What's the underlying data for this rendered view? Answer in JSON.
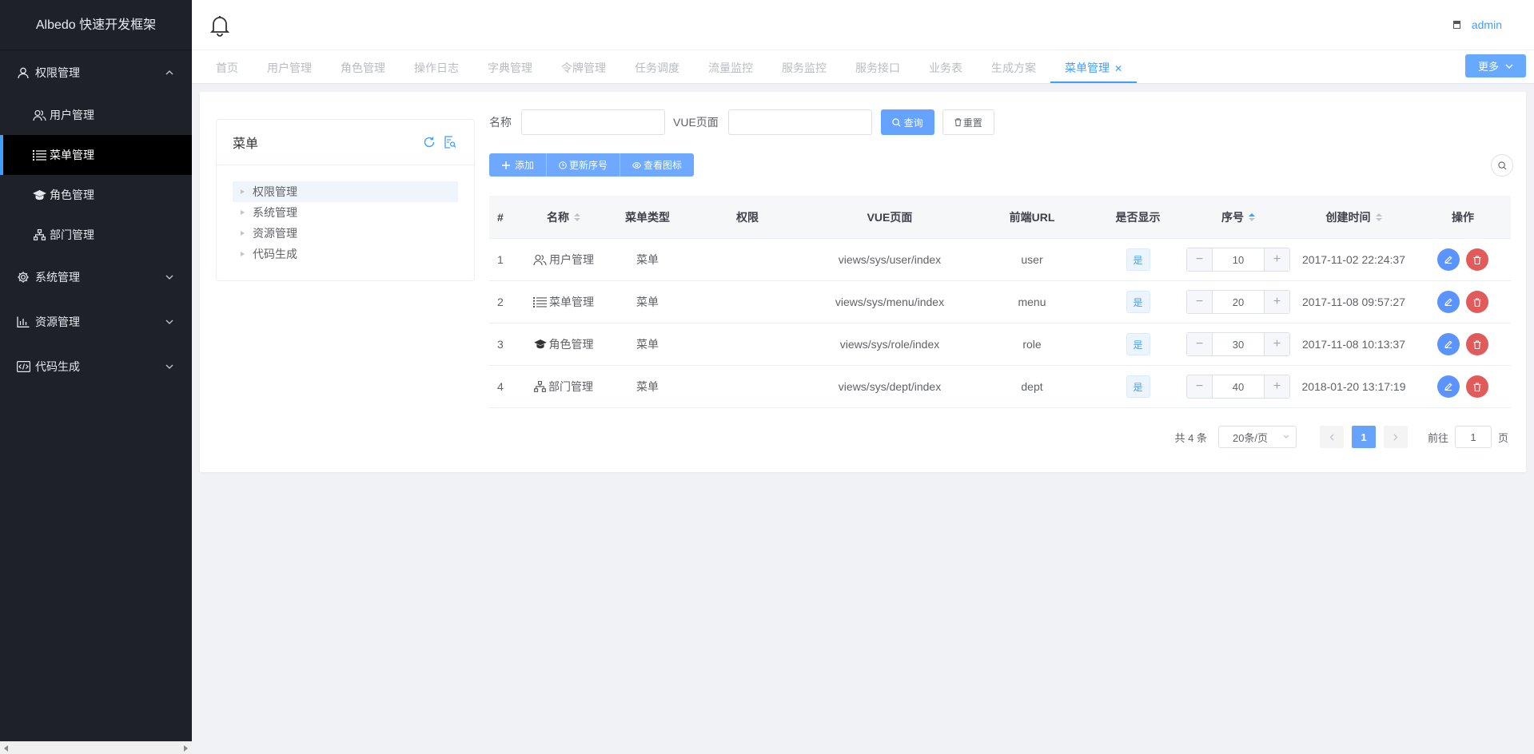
{
  "app": {
    "title": "Albedo 快速开发框架"
  },
  "sidebar": {
    "groups": [
      {
        "label": "权限管理",
        "icon": "user-icon",
        "expanded": true,
        "items": [
          {
            "label": "用户管理",
            "icon": "users-icon"
          },
          {
            "label": "菜单管理",
            "icon": "list-icon",
            "active": true
          },
          {
            "label": "角色管理",
            "icon": "graduation-cap-icon"
          },
          {
            "label": "部门管理",
            "icon": "sitemap-icon"
          }
        ]
      },
      {
        "label": "系统管理",
        "icon": "gear-icon"
      },
      {
        "label": "资源管理",
        "icon": "bar-chart-icon"
      },
      {
        "label": "代码生成",
        "icon": "code-icon"
      }
    ]
  },
  "header": {
    "user": "admin"
  },
  "tabs": {
    "items": [
      "首页",
      "用户管理",
      "角色管理",
      "操作日志",
      "字典管理",
      "令牌管理",
      "任务调度",
      "流量监控",
      "服务监控",
      "服务接口",
      "业务表",
      "生成方案",
      "菜单管理"
    ],
    "active": "菜单管理",
    "more_label": "更多"
  },
  "tree": {
    "title": "菜单",
    "nodes": [
      "权限管理",
      "系统管理",
      "资源管理",
      "代码生成"
    ]
  },
  "search": {
    "name_label": "名称",
    "vue_label": "VUE页面",
    "query_label": "查询",
    "reset_label": "重置"
  },
  "toolbar": {
    "add_label": "添加",
    "update_sort_label": "更新序号",
    "view_icons_label": "查看图标"
  },
  "table": {
    "headers": [
      "#",
      "名称",
      "菜单类型",
      "权限",
      "VUE页面",
      "前端URL",
      "是否显示",
      "序号",
      "创建时间",
      "操作"
    ],
    "rows": [
      {
        "idx": "1",
        "icon": "users-icon",
        "name": "用户管理",
        "type": "菜单",
        "perm": "",
        "vue": "views/sys/user/index",
        "url": "user",
        "show": "是",
        "sort": "10",
        "created": "2017-11-02 22:24:37"
      },
      {
        "idx": "2",
        "icon": "list-icon",
        "name": "菜单管理",
        "type": "菜单",
        "perm": "",
        "vue": "views/sys/menu/index",
        "url": "menu",
        "show": "是",
        "sort": "20",
        "created": "2017-11-08 09:57:27"
      },
      {
        "idx": "3",
        "icon": "graduation-cap-icon",
        "name": "角色管理",
        "type": "菜单",
        "perm": "",
        "vue": "views/sys/role/index",
        "url": "role",
        "show": "是",
        "sort": "30",
        "created": "2017-11-08 10:13:37"
      },
      {
        "idx": "4",
        "icon": "sitemap-icon",
        "name": "部门管理",
        "type": "菜单",
        "perm": "",
        "vue": "views/sys/dept/index",
        "url": "dept",
        "show": "是",
        "sort": "40",
        "created": "2018-01-20 13:17:19"
      }
    ]
  },
  "pagination": {
    "total_text": "共 4 条",
    "page_size": "20条/页",
    "current_page": "1",
    "goto_prefix": "前往",
    "goto_value": "1",
    "goto_suffix": "页"
  },
  "colors": {
    "primary": "#409eff",
    "sidebar_bg": "#1f2129",
    "danger": "#e25b5b"
  }
}
